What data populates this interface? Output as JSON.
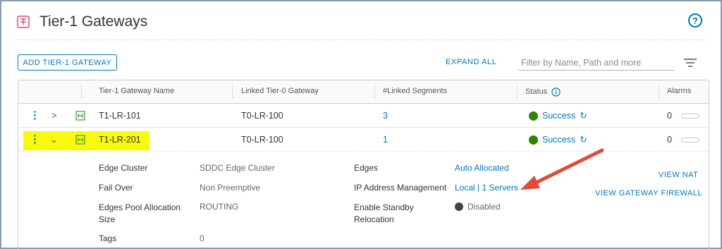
{
  "page": {
    "title": "Tier-1 Gateways",
    "help_glyph": "?"
  },
  "toolbar": {
    "add_label": "ADD TIER-1 GATEWAY",
    "expand_all_label": "EXPAND ALL",
    "filter_placeholder": "Filter by Name, Path and more"
  },
  "table": {
    "columns": [
      "Tier-1 Gateway Name",
      "Linked Tier-0 Gateway",
      "#Linked Segments",
      "Status",
      "Alarms"
    ],
    "rows": [
      {
        "name": "T1-LR-101",
        "linked_tier0": "T0-LR-100",
        "segments": "3",
        "status": "Success",
        "alarms": "0",
        "expanded": false
      },
      {
        "name": "T1-LR-201",
        "linked_tier0": "T0-LR-100",
        "segments": "1",
        "status": "Success",
        "alarms": "0",
        "expanded": true
      }
    ]
  },
  "details": {
    "edge_cluster_label": "Edge Cluster",
    "edge_cluster_value": "SDDC Edge Cluster",
    "fail_over_label": "Fail Over",
    "fail_over_value": "Non Preemptive",
    "edges_pool_label_1": "Edges Pool Allocation",
    "edges_pool_label_2": "Size",
    "edges_pool_value": "ROUTING",
    "tags_label": "Tags",
    "tags_value": "0",
    "edges_label": "Edges",
    "edges_value": "Auto Allocated",
    "ipam_label": "IP Address Management",
    "ipam_value": "Local | 1 Servers",
    "standby_label_1": "Enable Standby",
    "standby_label_2": "Relocation",
    "standby_value": "Disabled",
    "view_nat_label": "VIEW NAT",
    "view_firewall_label": "VIEW GATEWAY FIREWALL"
  },
  "colors": {
    "accent": "#0079b8",
    "success": "#2f8400",
    "highlight": "#f9f90c",
    "annotation_arrow": "#e04b3a",
    "gateway_icon": "#3c9a3c",
    "logo": "#e0457b"
  },
  "icons": {
    "logo": "tier1-gateway-logo-icon",
    "help": "help-circle-icon",
    "filter": "filter-lines-icon",
    "row_menu": "kebab-vertical-icon",
    "collapsed": "chevron-right-icon",
    "expanded": "chevron-down-icon",
    "gateway": "gateway-router-icon",
    "refresh": "refresh-icon",
    "info": "info-circle-icon"
  }
}
